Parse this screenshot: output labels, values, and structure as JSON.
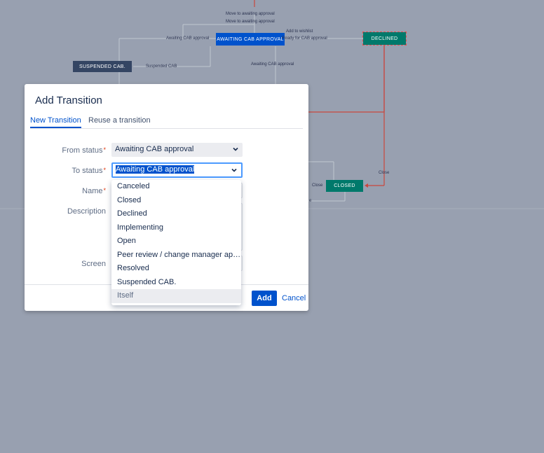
{
  "diagram": {
    "statuses": {
      "awaiting": "AWAITING CAB APPROVAL",
      "declined": "DECLINED",
      "suspended": "SUSPENDED CAB.",
      "closed": "CLOSED"
    },
    "edge_labels": {
      "move1": "Move to awaiting approval",
      "move2": "Move to awaiting approval",
      "awaiting_left": "Awaiting CAB approval",
      "add_wishlist": "Add to wishlist",
      "ready": "Ready for CAB approval",
      "suspended": "Suspended CAB",
      "awaiting_below": "Awaiting CAB approval",
      "close_right": "Close",
      "close_left": "Close",
      "e_fragment": "e"
    },
    "colors": {
      "dark_node": "#344563",
      "awaiting_node": "#0052cc",
      "green_node": "#00796b",
      "declined_border": "#e05050",
      "red_line": "#c9463d",
      "gray_line": "#c1c7d0"
    }
  },
  "dialog": {
    "title": "Add Transition",
    "tabs": [
      "New Transition",
      "Reuse a transition"
    ],
    "fields": {
      "from_status": {
        "label": "From status",
        "required": "*",
        "value": "Awaiting CAB approval"
      },
      "to_status": {
        "label": "To status",
        "required": "*",
        "value": "Awaiting CAB approval"
      },
      "name": {
        "label": "Name",
        "required": "*",
        "value": ""
      },
      "description": {
        "label": "Description",
        "value": ""
      },
      "screen": {
        "label": "Screen",
        "value": ""
      }
    },
    "buttons": {
      "add": "Add",
      "cancel": "Cancel"
    }
  },
  "dropdown": {
    "options": [
      "Canceled",
      "Closed",
      "Declined",
      "Implementing",
      "Open",
      "Peer review / change manager app...",
      "Resolved",
      "Suspended CAB.",
      "Itself"
    ],
    "hovered_index": 8
  }
}
